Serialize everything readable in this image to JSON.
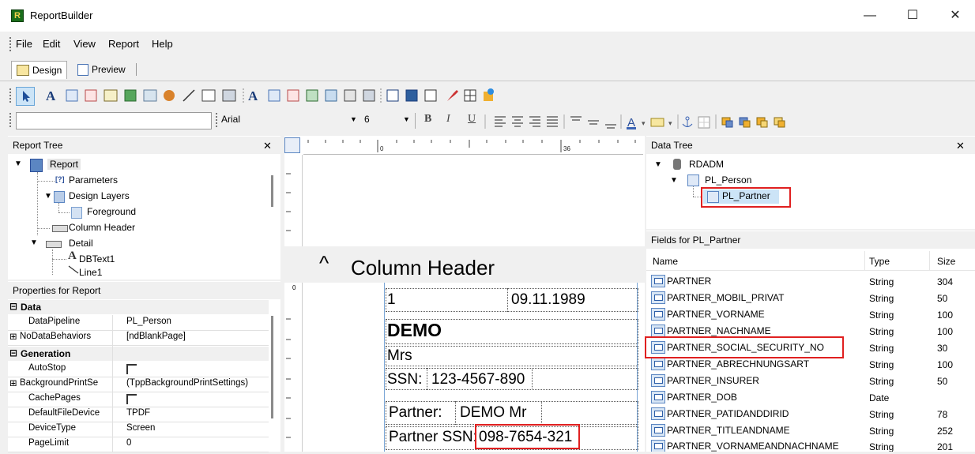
{
  "window": {
    "title": "ReportBuilder",
    "app_icon_letter": "R",
    "minimize": "—",
    "maximize": "☐",
    "close": "✕"
  },
  "menu": [
    "File",
    "Edit",
    "View",
    "Report",
    "Help"
  ],
  "tabs": [
    {
      "label": "Design",
      "active": true
    },
    {
      "label": "Preview",
      "active": false
    }
  ],
  "format_toolbar": {
    "font_name": "Arial",
    "font_size": "6",
    "bold": "B",
    "italic": "I",
    "underline": "U",
    "font_color": "A"
  },
  "report_tree": {
    "title": "Report Tree",
    "close": "✕",
    "items": [
      {
        "label": "Report",
        "selected": true
      },
      {
        "label": "Parameters"
      },
      {
        "label": "Design Layers"
      },
      {
        "label": "Foreground"
      },
      {
        "label": "Column Header"
      },
      {
        "label": "Detail"
      },
      {
        "label": "DBText1"
      },
      {
        "label": "Line1"
      }
    ]
  },
  "properties": {
    "title": "Properties for Report",
    "categories": [
      {
        "name": "Data",
        "rows": [
          {
            "name": "DataPipeline",
            "value": "PL_Person"
          },
          {
            "name": "NoDataBehaviors",
            "value": "[ndBlankPage]",
            "expandable": true
          }
        ]
      },
      {
        "name": "Generation",
        "rows": [
          {
            "name": "AutoStop",
            "value": "checkbox"
          },
          {
            "name": "BackgroundPrintSe",
            "value": "(TppBackgroundPrintSettings)",
            "expandable": true
          },
          {
            "name": "CachePages",
            "value": "checkbox"
          },
          {
            "name": "DefaultFileDevice",
            "value": "TPDF"
          },
          {
            "name": "DeviceType",
            "value": "Screen"
          },
          {
            "name": "PageLimit",
            "value": "0"
          }
        ]
      }
    ],
    "collapse_sign": "⊟",
    "expand_sign": "⊞"
  },
  "design": {
    "ruler_marks": [
      "0",
      "36"
    ],
    "vertical_ruler_mark": "0",
    "band_caret": "^",
    "band_label": "Column Header",
    "fields": {
      "line1_num": "1",
      "line1_date": "09.11.1989",
      "name": "DEMO",
      "salutation": "Mrs",
      "ssn_label": "SSN:",
      "ssn_value": "123-4567-890",
      "partner_label": "Partner:",
      "partner_value": "DEMO Mr",
      "partner_ssn_label": "Partner SSN:",
      "partner_ssn_value": "098-7654-321"
    }
  },
  "data_tree": {
    "title": "Data Tree",
    "close": "✕",
    "nodes": [
      {
        "label": "RDADM"
      },
      {
        "label": "PL_Person"
      },
      {
        "label": "PL_Partner",
        "highlighted": true
      }
    ]
  },
  "fields_panel": {
    "title": "Fields for PL_Partner",
    "columns": [
      "Name",
      "Type",
      "Size"
    ],
    "rows": [
      {
        "name": "PARTNER",
        "type": "String",
        "size": "304"
      },
      {
        "name": "PARTNER_MOBIL_PRIVAT",
        "type": "String",
        "size": "50"
      },
      {
        "name": "PARTNER_VORNAME",
        "type": "String",
        "size": "100"
      },
      {
        "name": "PARTNER_NACHNAME",
        "type": "String",
        "size": "100"
      },
      {
        "name": "PARTNER_SOCIAL_SECURITY_NO",
        "type": "String",
        "size": "30",
        "highlighted": true
      },
      {
        "name": "PARTNER_ABRECHNUNGSART",
        "type": "String",
        "size": "100"
      },
      {
        "name": "PARTNER_INSURER",
        "type": "String",
        "size": "50"
      },
      {
        "name": "PARTNER_DOB",
        "type": "Date",
        "size": ""
      },
      {
        "name": "PARTNER_PATIDANDDIRID",
        "type": "String",
        "size": "78"
      },
      {
        "name": "PARTNER_TITLEANDNAME",
        "type": "String",
        "size": "252"
      },
      {
        "name": "PARTNER_VORNAMEANDNACHNAME",
        "type": "String",
        "size": "201"
      }
    ]
  },
  "colors": {
    "highlight": "#e02020",
    "selection": "#cce4f7",
    "toolbar_bg": "#f0f0f0"
  }
}
